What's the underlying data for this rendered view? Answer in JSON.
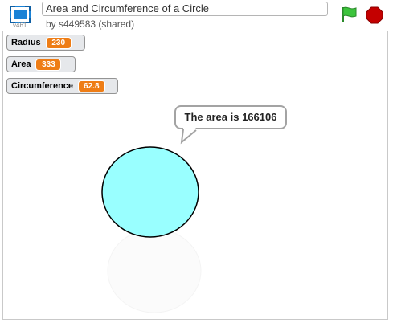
{
  "header": {
    "project_title": "Area and Circumference of a Circle",
    "byline": "by s449583 (shared)",
    "version": "v461",
    "fullscreen_icon": "fullscreen-icon",
    "flag_icon": "green-flag-icon",
    "stop_icon": "stop-sign-icon",
    "colors": {
      "fullscreen": "#1a82d6",
      "flag": "#3cc43c",
      "stop": "#c40000"
    }
  },
  "stage": {
    "monitors": [
      {
        "label": "Radius",
        "value": "230"
      },
      {
        "label": "Area",
        "value": "333"
      },
      {
        "label": "Circumference",
        "value": "62.8"
      }
    ],
    "speech_bubble": "The area is 166106",
    "sprite_fill": "#99ffff",
    "monitor_value_color": "#ee7d16"
  }
}
